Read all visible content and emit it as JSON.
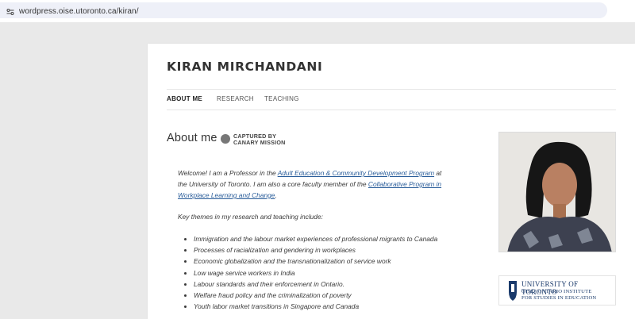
{
  "browser": {
    "url": "wordpress.oise.utoronto.ca/kiran/"
  },
  "site": {
    "title": "KIRAN MIRCHANDANI"
  },
  "nav": [
    {
      "label": "ABOUT ME",
      "active": true
    },
    {
      "label": "RESEARCH",
      "active": false
    },
    {
      "label": "TEACHING",
      "active": false
    }
  ],
  "page": {
    "heading": "About me",
    "badge": {
      "line1": "CAPTURED BY",
      "line2": "CANARY MISSION"
    }
  },
  "intro": {
    "t1": "Welcome! I am a Professor in the ",
    "link1": "Adult Education & Community Development Program",
    "t2": " at the University of Toronto. I am also a core faculty member of the ",
    "link2": "Collaborative Program in Workplace Learning and Change",
    "t3": "."
  },
  "themes_intro": "Key themes in my research and teaching include:",
  "themes": [
    "Immigration and the labour market experiences of professional migrants to Canada",
    "Processes of racialization and gendering in workplaces",
    "Economic globalization and the transnationalization of service work",
    "Low wage service workers in India",
    "Labour standards and their enforcement in Ontario.",
    "Welfare fraud policy and the criminalization of poverty",
    "Youth labor market transitions in Singapore and Canada"
  ],
  "logo": {
    "line1": "UNIVERSITY OF TORONTO",
    "line2": "OISE | ONTARIO INSTITUTE",
    "line3": "FOR STUDIES IN EDUCATION"
  },
  "colors": {
    "link": "#2a5d9a",
    "logo": "#1a3a6b",
    "page_bg": "#e9e9e9"
  }
}
